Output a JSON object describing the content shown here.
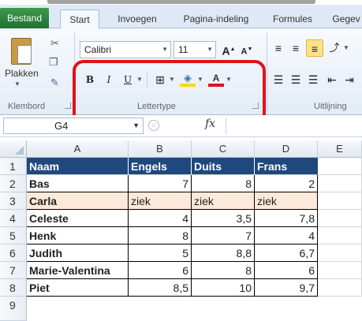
{
  "tabs": [
    {
      "label": "Bestand",
      "kind": "file"
    },
    {
      "label": "Start",
      "kind": "active"
    },
    {
      "label": "Invoegen",
      "kind": "normal"
    },
    {
      "label": "Pagina-indeling",
      "kind": "normal"
    },
    {
      "label": "Formules",
      "kind": "normal"
    },
    {
      "label": "Gegev",
      "kind": "normal"
    }
  ],
  "ribbon": {
    "clipboard": {
      "paste_label": "Plakken",
      "group_label": "Klembord"
    },
    "font": {
      "font_name": "Calibri",
      "font_size": "11",
      "group_label": "Lettertype",
      "bold": "B",
      "italic": "I",
      "underline": "U",
      "grow": "A",
      "shrink": "A",
      "color_letter": "A"
    },
    "alignment": {
      "group_label": "Uitlijning"
    }
  },
  "formula_bar": {
    "name_box": "G4",
    "fx": "fx",
    "value": ""
  },
  "grid": {
    "columns": [
      "A",
      "B",
      "C",
      "D",
      "E"
    ],
    "rows": [
      "1",
      "2",
      "3",
      "4",
      "5",
      "6",
      "7",
      "8",
      "9"
    ],
    "header": [
      "Naam",
      "Engels",
      "Duits",
      "Frans"
    ],
    "data": [
      {
        "name": "Bas",
        "engels": "7",
        "duits": "8",
        "frans": "2",
        "ziek": false
      },
      {
        "name": "Carla",
        "engels": "ziek",
        "duits": "ziek",
        "frans": "ziek",
        "ziek": true
      },
      {
        "name": "Celeste",
        "engels": "4",
        "duits": "3,5",
        "frans": "7,8",
        "ziek": false
      },
      {
        "name": "Henk",
        "engels": "8",
        "duits": "7",
        "frans": "4",
        "ziek": false
      },
      {
        "name": "Judith",
        "engels": "5",
        "duits": "8,8",
        "frans": "6,7",
        "ziek": false
      },
      {
        "name": "Marie-Valentina",
        "engels": "6",
        "duits": "8",
        "frans": "6",
        "ziek": false
      },
      {
        "name": "Piet",
        "engels": "8,5",
        "duits": "10",
        "frans": "9,7",
        "ziek": false
      }
    ]
  },
  "colors": {
    "header_fill": "#1f497d",
    "ziek_fill": "#fde9d9",
    "highlight_border": "#e0121a",
    "file_tab": "#2a7d3a"
  }
}
